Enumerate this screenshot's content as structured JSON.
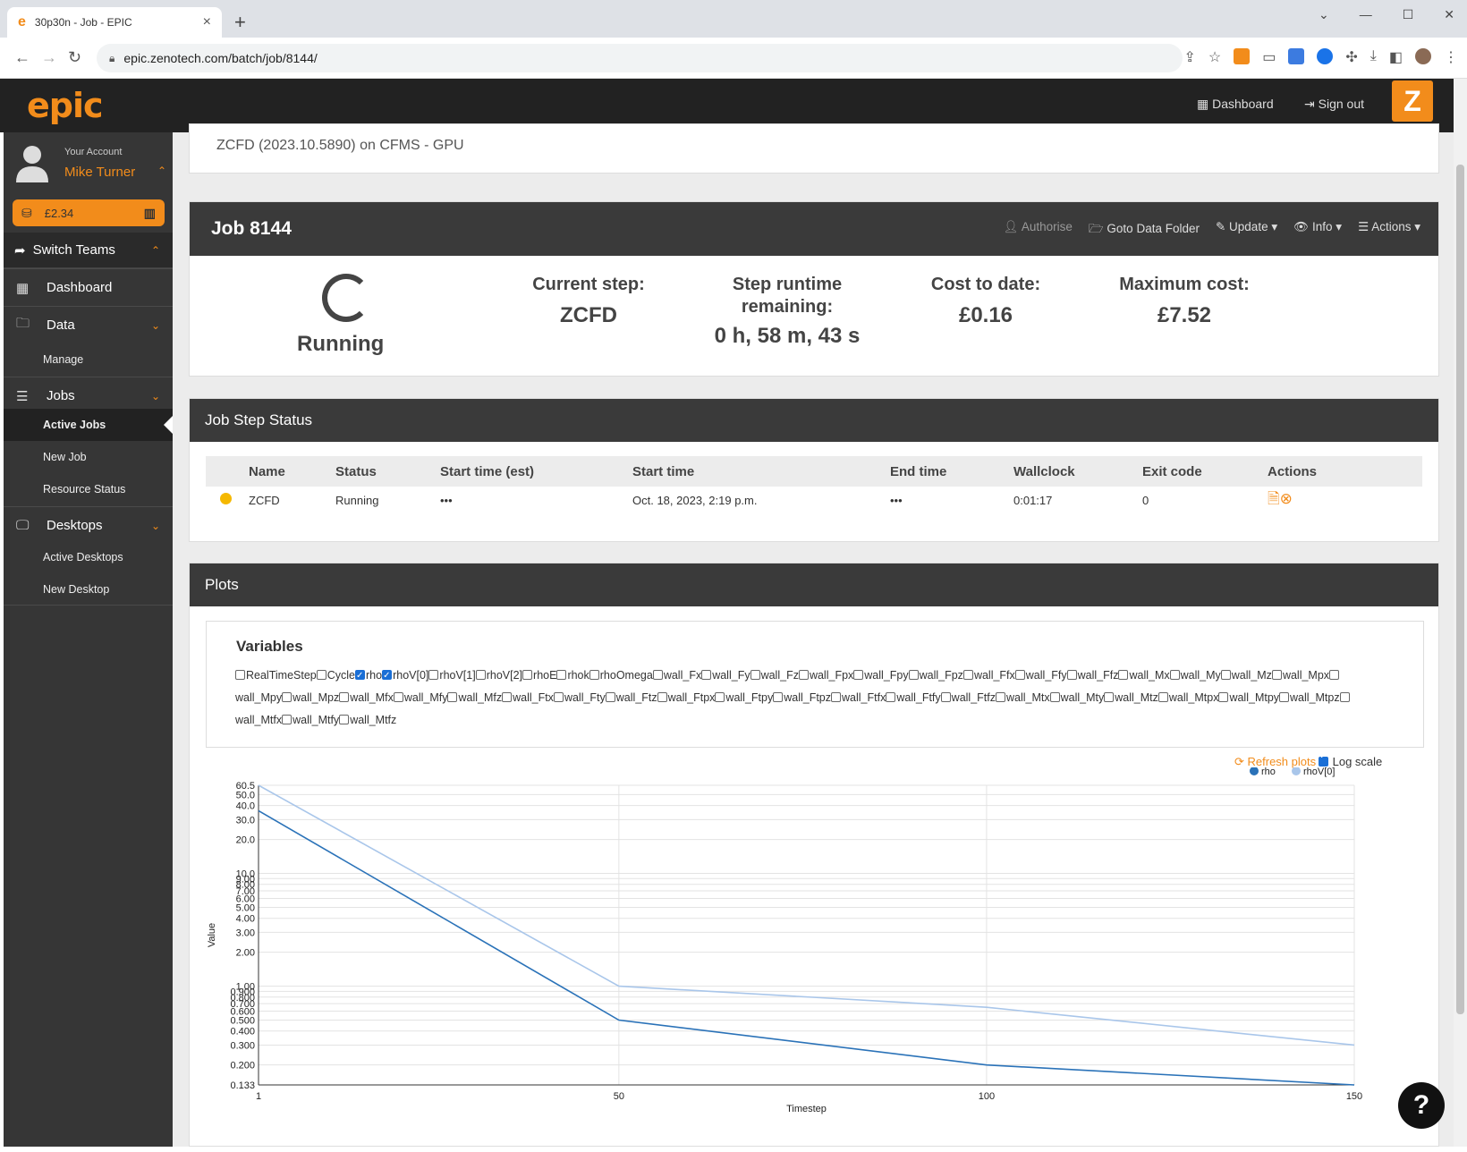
{
  "browser": {
    "tab_title": "30p30n - Job - EPIC",
    "url": "epic.zenotech.com/batch/job/8144/"
  },
  "header": {
    "logo": "epic",
    "dashboard": "Dashboard",
    "signout": "Sign out"
  },
  "account": {
    "label": "Your Account",
    "name": "Mike Turner",
    "credit": "£2.34"
  },
  "sidebar": {
    "switch_teams": "Switch Teams",
    "dashboard": "Dashboard",
    "data": "Data",
    "data_manage": "Manage",
    "jobs": "Jobs",
    "active_jobs": "Active Jobs",
    "new_job": "New Job",
    "resource_status": "Resource Status",
    "desktops": "Desktops",
    "active_desktops": "Active Desktops",
    "new_desktop": "New Desktop"
  },
  "job": {
    "subtitle": "ZCFD (2023.10.5890) on CFMS - GPU",
    "title": "Job 8144",
    "actions": {
      "authorise": "Authorise",
      "goto": "Goto Data Folder",
      "update": "Update",
      "info": "Info",
      "actions": "Actions"
    },
    "status": "Running",
    "current_step_label": "Current step:",
    "current_step": "ZCFD",
    "runtime_label_1": "Step runtime",
    "runtime_label_2": "remaining:",
    "runtime": "0 h, 58 m, 43 s",
    "cost_label": "Cost to date:",
    "cost": "£0.16",
    "max_label": "Maximum cost:",
    "max": "£7.52"
  },
  "step_status": {
    "title": "Job Step Status",
    "columns": [
      "Name",
      "Status",
      "Start time (est)",
      "Start time",
      "End time",
      "Wallclock",
      "Exit code",
      "Actions"
    ],
    "row": {
      "name": "ZCFD",
      "status": "Running",
      "start_est": "•••",
      "start": "Oct. 18, 2023, 2:19 p.m.",
      "end": "•••",
      "wallclock": "0:01:17",
      "exit": "0"
    }
  },
  "plots": {
    "title": "Plots",
    "variables_title": "Variables",
    "variables": [
      {
        "name": "RealTimeStep",
        "checked": false
      },
      {
        "name": "Cycle",
        "checked": false
      },
      {
        "name": "rho",
        "checked": true
      },
      {
        "name": "rhoV[0]",
        "checked": true
      },
      {
        "name": "rhoV[1]",
        "checked": false
      },
      {
        "name": "rhoV[2]",
        "checked": false
      },
      {
        "name": "rhoE",
        "checked": false
      },
      {
        "name": "rhok",
        "checked": false
      },
      {
        "name": "rhoOmega",
        "checked": false
      },
      {
        "name": "wall_Fx",
        "checked": false
      },
      {
        "name": "wall_Fy",
        "checked": false
      },
      {
        "name": "wall_Fz",
        "checked": false
      },
      {
        "name": "wall_Fpx",
        "checked": false
      },
      {
        "name": "wall_Fpy",
        "checked": false
      },
      {
        "name": "wall_Fpz",
        "checked": false
      },
      {
        "name": "wall_Ffx",
        "checked": false
      },
      {
        "name": "wall_Ffy",
        "checked": false
      },
      {
        "name": "wall_Ffz",
        "checked": false
      },
      {
        "name": "wall_Mx",
        "checked": false
      },
      {
        "name": "wall_My",
        "checked": false
      },
      {
        "name": "wall_Mz",
        "checked": false
      },
      {
        "name": "wall_Mpx",
        "checked": false
      },
      {
        "name": "wall_Mpy",
        "checked": false
      },
      {
        "name": "wall_Mpz",
        "checked": false
      },
      {
        "name": "wall_Mfx",
        "checked": false
      },
      {
        "name": "wall_Mfy",
        "checked": false
      },
      {
        "name": "wall_Mfz",
        "checked": false
      },
      {
        "name": "wall_Ftx",
        "checked": false
      },
      {
        "name": "wall_Fty",
        "checked": false
      },
      {
        "name": "wall_Ftz",
        "checked": false
      },
      {
        "name": "wall_Ftpx",
        "checked": false
      },
      {
        "name": "wall_Ftpy",
        "checked": false
      },
      {
        "name": "wall_Ftpz",
        "checked": false
      },
      {
        "name": "wall_Ftfx",
        "checked": false
      },
      {
        "name": "wall_Ftfy",
        "checked": false
      },
      {
        "name": "wall_Ftfz",
        "checked": false
      },
      {
        "name": "wall_Mtx",
        "checked": false
      },
      {
        "name": "wall_Mty",
        "checked": false
      },
      {
        "name": "wall_Mtz",
        "checked": false
      },
      {
        "name": "wall_Mtpx",
        "checked": false
      },
      {
        "name": "wall_Mtpy",
        "checked": false
      },
      {
        "name": "wall_Mtpz",
        "checked": false
      },
      {
        "name": "wall_Mtfx",
        "checked": false
      },
      {
        "name": "wall_Mtfy",
        "checked": false
      },
      {
        "name": "wall_Mtfz",
        "checked": false
      }
    ],
    "refresh": "Refresh plots",
    "logscale": "Log scale",
    "logscale_checked": true
  },
  "chart_data": {
    "type": "line",
    "xlabel": "Timestep",
    "ylabel": "Value",
    "log_y": true,
    "xlim": [
      1,
      150
    ],
    "ylim": [
      0.133,
      60.5
    ],
    "x_ticks": [
      "1",
      "50",
      "100",
      "150"
    ],
    "y_ticks": [
      "60.5",
      "50.0",
      "40.0",
      "30.0",
      "20.0",
      "10.0",
      "9.00",
      "8.00",
      "7.00",
      "6.00",
      "5.00",
      "4.00",
      "3.00",
      "2.00",
      "1.00",
      "0.900",
      "0.800",
      "0.700",
      "0.600",
      "0.500",
      "0.400",
      "0.300",
      "0.200",
      "0.133"
    ],
    "legend_position": "top-right",
    "series": [
      {
        "name": "rho",
        "color": "#2a72b8",
        "x": [
          1,
          50,
          100,
          150
        ],
        "y": [
          36,
          0.5,
          0.2,
          0.133
        ]
      },
      {
        "name": "rhoV[0]",
        "color": "#a9c6ea",
        "x": [
          1,
          50,
          100,
          150
        ],
        "y": [
          60.5,
          1.0,
          0.65,
          0.3
        ]
      }
    ]
  },
  "colors": {
    "accent": "#f28c1b",
    "dark": "#222222",
    "sidebar": "#363636"
  }
}
